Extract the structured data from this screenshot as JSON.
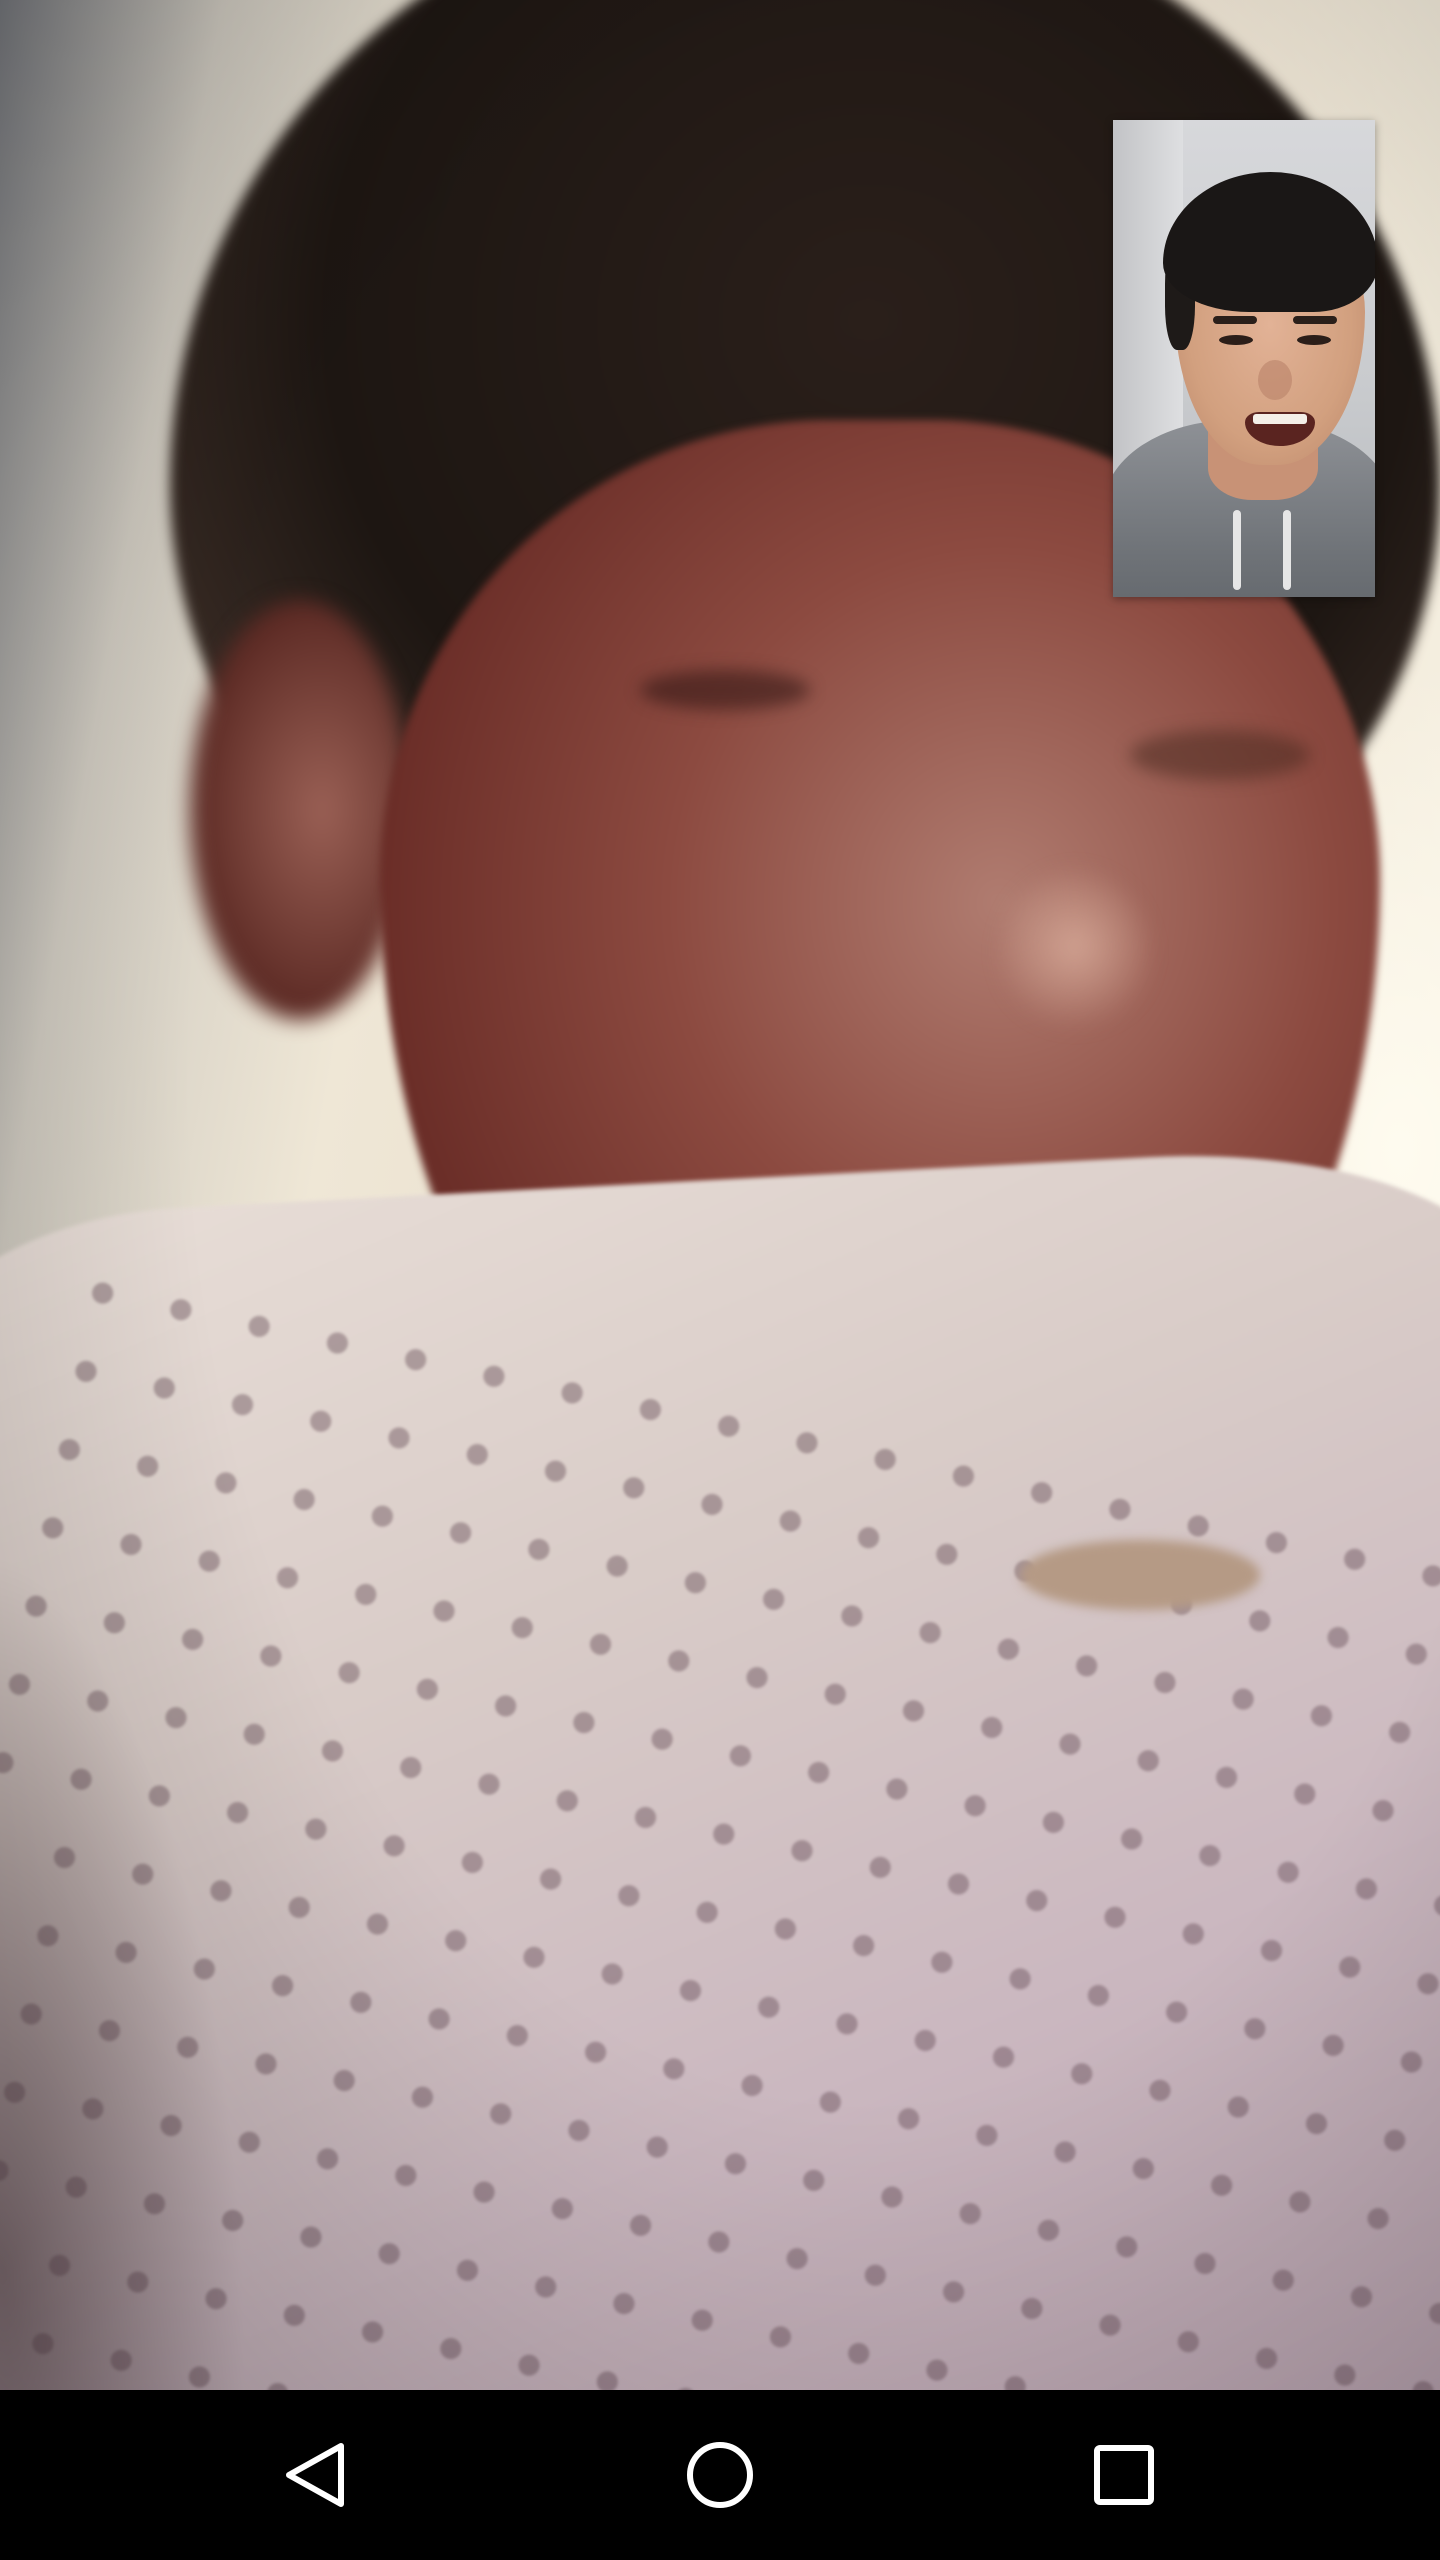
{
  "app": {
    "screen": "video-call",
    "background_color": "#000000"
  },
  "remote_video": {
    "icon": "remote-participant-video"
  },
  "self_view": {
    "icon": "local-camera-preview"
  },
  "nav_bar": {
    "background_color": "#000000",
    "icon_color": "#ffffff",
    "buttons": [
      {
        "icon": "back-triangle-icon"
      },
      {
        "icon": "home-circle-icon"
      },
      {
        "icon": "recents-square-icon"
      }
    ]
  }
}
